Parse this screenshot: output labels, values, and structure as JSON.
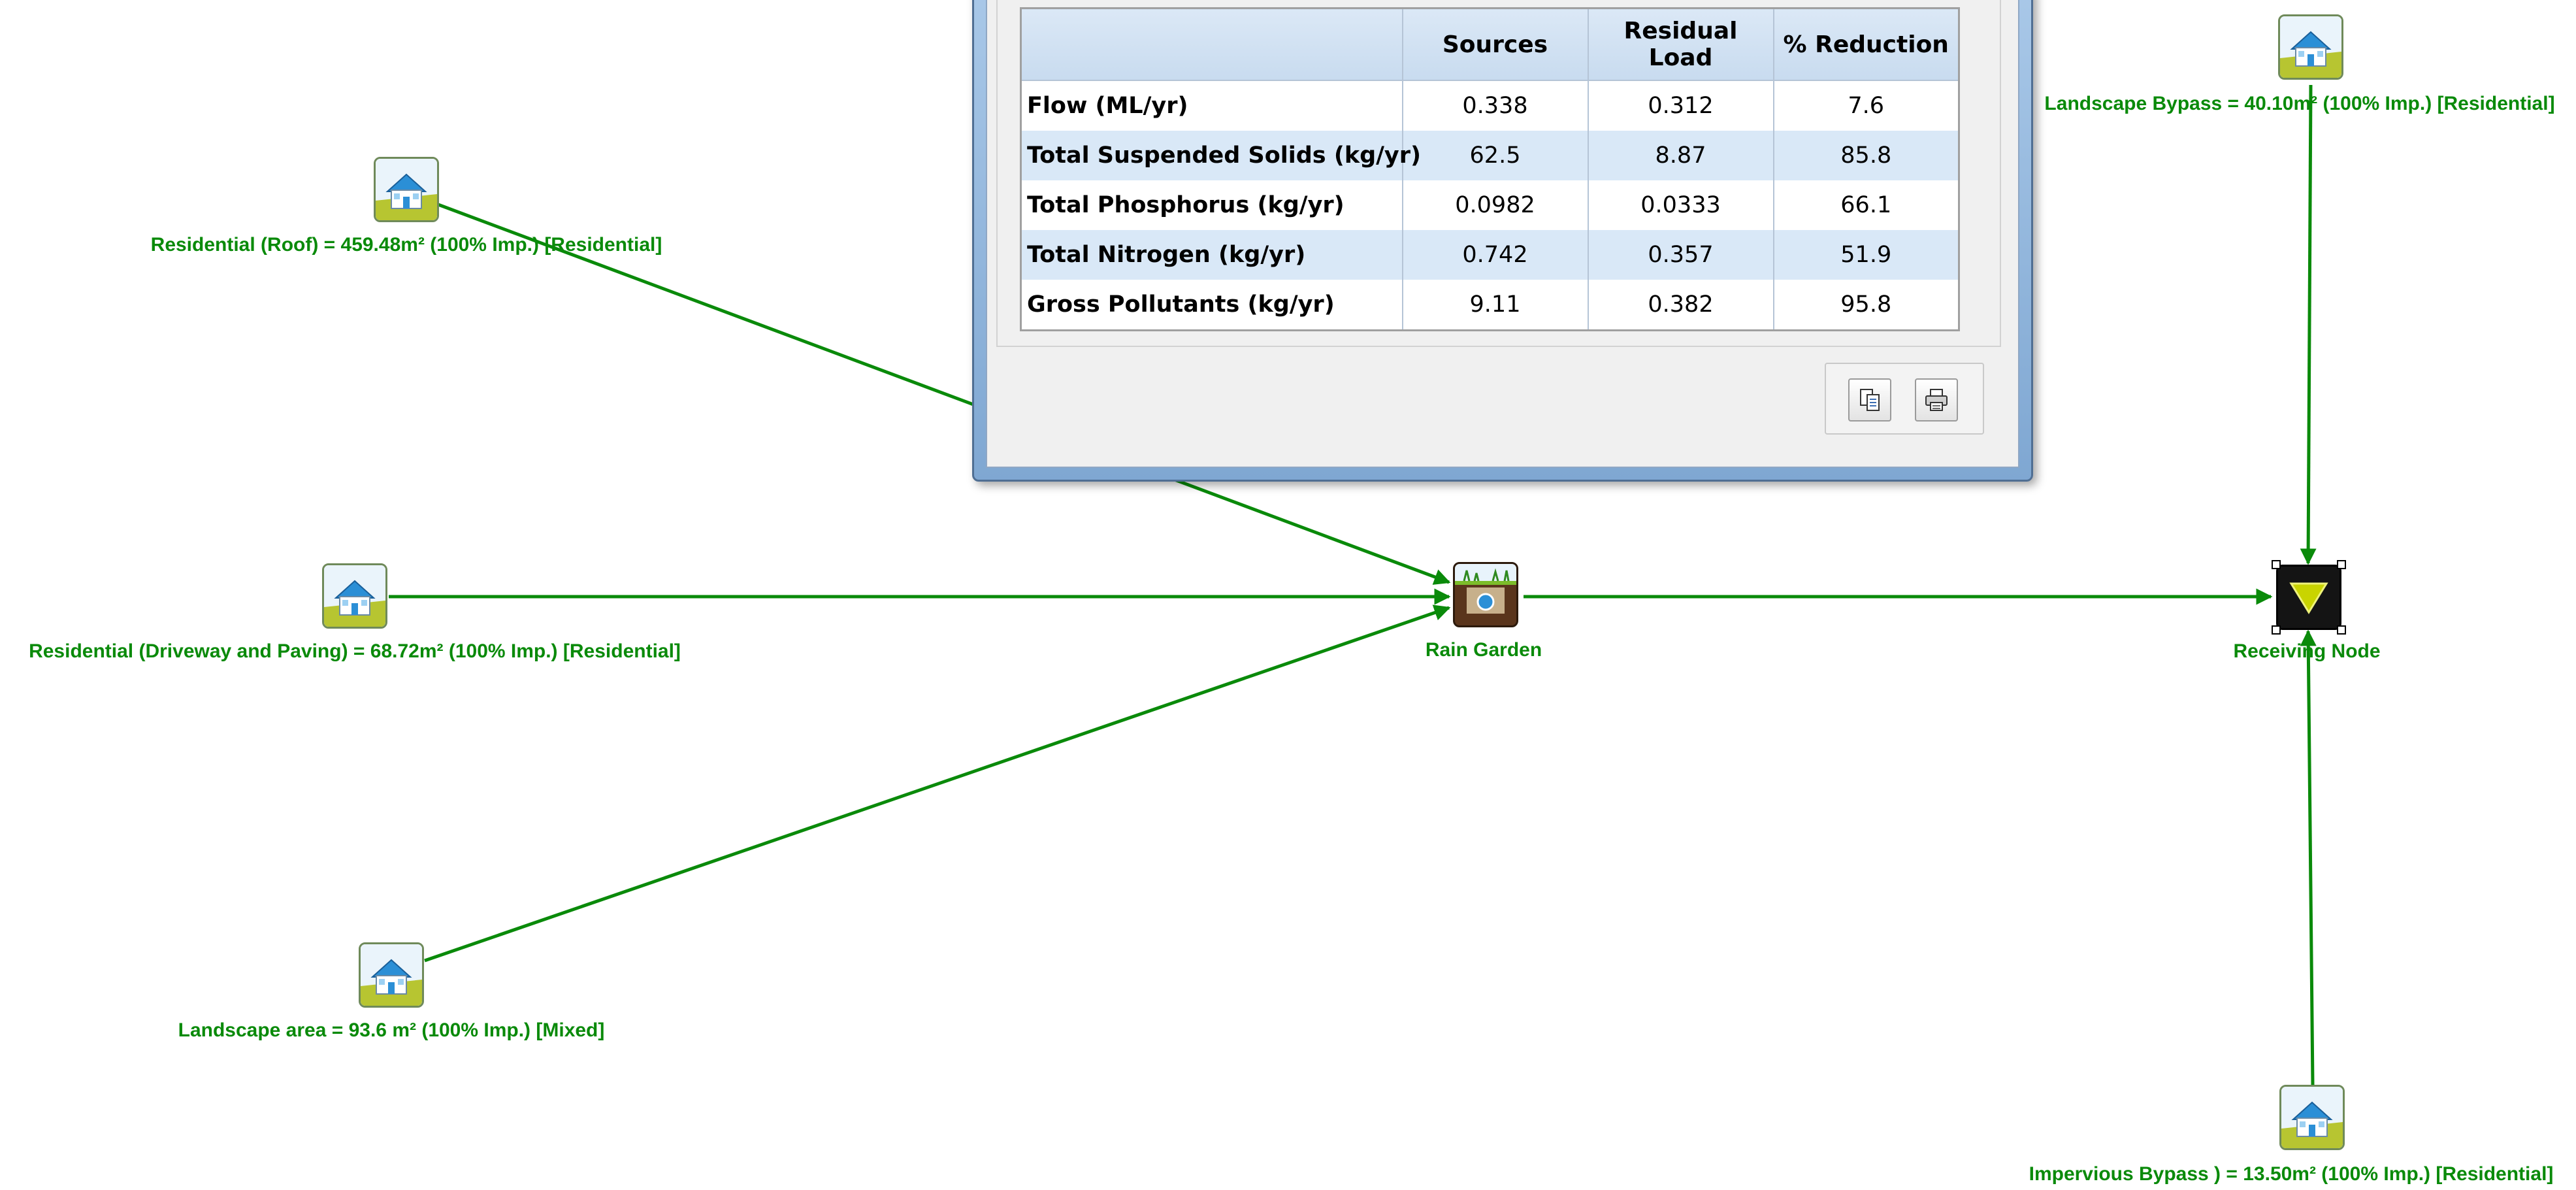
{
  "nodes": {
    "roof": {
      "label": "Residential (Roof) =  459.48m² (100% Imp.) [Residential]",
      "icon": "house-icon"
    },
    "driveway": {
      "label": "Residential (Driveway and Paving) =  68.72m² (100% Imp.) [Residential]",
      "icon": "house-icon"
    },
    "landscape_area": {
      "label": "Landscape area  = 93.6 m² (100% Imp.) [Mixed]",
      "icon": "house-icon"
    },
    "rain_garden": {
      "label": "Rain Garden",
      "icon": "rain-garden-icon"
    },
    "receiving_node": {
      "label": "Receiving Node",
      "icon": "receiving-node-icon"
    },
    "landscape_bypass": {
      "label": "Landscape Bypass =  40.10m² (100% Imp.) [Residential]",
      "icon": "house-icon"
    },
    "impervious_bypass": {
      "label": "Impervious Bypass ) = 13.50m² (100% Imp.) [Residential]",
      "icon": "house-icon"
    }
  },
  "results": {
    "columns": [
      "",
      "Sources",
      "Residual Load",
      "% Reduction"
    ],
    "rows": [
      {
        "label": "Flow (ML/yr)",
        "sources": "0.338",
        "residual": "0.312",
        "reduction": "7.6"
      },
      {
        "label": "Total Suspended Solids (kg/yr)",
        "sources": "62.5",
        "residual": "8.87",
        "reduction": "85.8"
      },
      {
        "label": "Total Phosphorus (kg/yr)",
        "sources": "0.0982",
        "residual": "0.0333",
        "reduction": "66.1"
      },
      {
        "label": "Total Nitrogen (kg/yr)",
        "sources": "0.742",
        "residual": "0.357",
        "reduction": "51.9"
      },
      {
        "label": "Gross Pollutants (kg/yr)",
        "sources": "9.11",
        "residual": "0.382",
        "reduction": "95.8"
      }
    ],
    "buttons": [
      {
        "name": "copy-button",
        "icon": "copy-icon"
      },
      {
        "name": "print-button",
        "icon": "printer-icon"
      }
    ]
  },
  "colors": {
    "link": "#0a8a0a",
    "label": "#0a8a0a",
    "table_alt_row": "#d9e8f7",
    "table_header": "#c8dbef"
  }
}
